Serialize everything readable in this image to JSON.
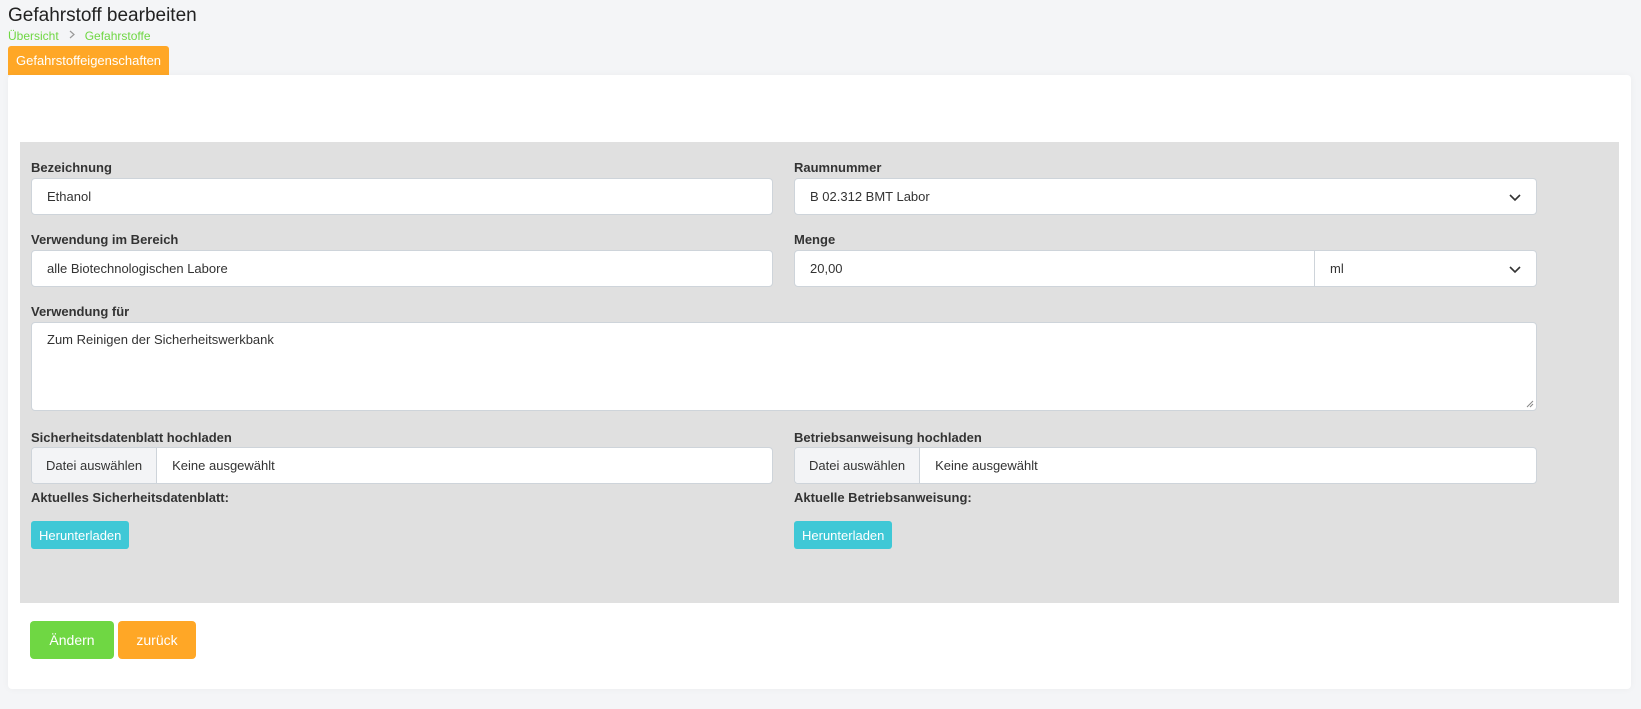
{
  "header": {
    "title": "Gefahrstoff bearbeiten",
    "breadcrumb": [
      "Übersicht",
      "Gefahrstoffe"
    ],
    "tab_label": "Gefahrstoffeigenschaften"
  },
  "form": {
    "bezeichnung": {
      "label": "Bezeichnung",
      "value": "Ethanol"
    },
    "raumnummer": {
      "label": "Raumnummer",
      "value": "B 02.312 BMT Labor"
    },
    "bereich": {
      "label": "Verwendung im Bereich",
      "value": "alle Biotechnologischen Labore"
    },
    "menge": {
      "label": "Menge",
      "value": "20,00",
      "unit": "ml"
    },
    "verwendung": {
      "label": "Verwendung für",
      "value": "Zum Reinigen der Sicherheitswerkbank"
    },
    "sdb_upload": {
      "label": "Sicherheitsdatenblatt hochladen",
      "button": "Datei auswählen",
      "filename": "Keine ausgewählt"
    },
    "ba_upload": {
      "label": "Betriebsanweisung hochladen",
      "button": "Datei auswählen",
      "filename": "Keine ausgewählt"
    },
    "current_sdb": {
      "label": "Aktuelles Sicherheitsdatenblatt:",
      "button": "Herunterladen"
    },
    "current_ba": {
      "label": "Aktuelle Betriebsanweisung:",
      "button": "Herunterladen"
    }
  },
  "actions": {
    "change": "Ändern",
    "back": "zurück"
  },
  "colors": {
    "green": "#6fd743",
    "orange": "#ffa726",
    "cyan": "#3fc8d6",
    "panel": "#e0e0e0"
  }
}
